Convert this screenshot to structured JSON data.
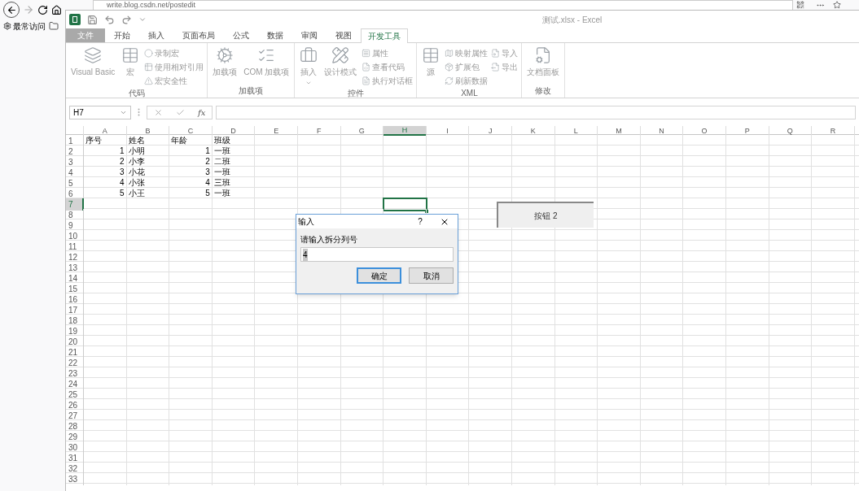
{
  "browser": {
    "url": "write.blog.csdn.net/postedit",
    "bookmarks": [
      {
        "label": "最常访问",
        "kind": "gear"
      },
      {
        "kind": "folder"
      }
    ]
  },
  "window": {
    "title": "测试.xlsx - Excel"
  },
  "tabs": [
    {
      "label": "文件",
      "kind": "file",
      "selected": false
    },
    {
      "label": "开始",
      "kind": "tab",
      "selected": false
    },
    {
      "label": "插入",
      "kind": "tab",
      "selected": false
    },
    {
      "label": "页面布局",
      "kind": "tab",
      "selected": false
    },
    {
      "label": "公式",
      "kind": "tab",
      "selected": false
    },
    {
      "label": "数据",
      "kind": "tab",
      "selected": false
    },
    {
      "label": "审阅",
      "kind": "tab",
      "selected": false
    },
    {
      "label": "视图",
      "kind": "tab",
      "selected": false
    },
    {
      "label": "开发工具",
      "kind": "tab",
      "selected": true
    }
  ],
  "ribbon_groups": [
    {
      "title": "代码",
      "large": [
        {
          "label": "Visual Basic",
          "disabled": true
        },
        {
          "label": "宏",
          "disabled": true
        }
      ],
      "small": [
        [
          {
            "label": "录制宏",
            "disabled": true
          },
          {
            "label": "使用相对引用",
            "disabled": true
          },
          {
            "label": "宏安全性",
            "disabled": true
          }
        ]
      ]
    },
    {
      "title": "加载项",
      "large": [
        {
          "label": "加载项",
          "disabled": true
        },
        {
          "label": "COM 加载项",
          "disabled": true
        }
      ]
    },
    {
      "title": "控件",
      "large": [
        {
          "label": "插入",
          "disabled": true,
          "dropdown": true
        },
        {
          "label": "设计模式",
          "disabled": true
        }
      ],
      "small": [
        [
          {
            "label": "属性",
            "disabled": true
          },
          {
            "label": "查看代码",
            "disabled": true
          },
          {
            "label": "执行对话框",
            "disabled": true
          }
        ]
      ]
    },
    {
      "title": "XML",
      "large": [
        {
          "label": "源",
          "disabled": true
        }
      ],
      "small": [
        [
          {
            "label": "映射属性",
            "disabled": true
          },
          {
            "label": "扩展包",
            "disabled": true
          },
          {
            "label": "刷新数据",
            "disabled": true
          }
        ],
        [
          {
            "label": "导入",
            "disabled": true
          },
          {
            "label": "导出",
            "disabled": true
          }
        ]
      ]
    },
    {
      "title": "修改",
      "large": [
        {
          "label": "文档面板",
          "disabled": true
        }
      ]
    }
  ],
  "formula_bar": {
    "name_box": "H7",
    "function_label": "fx"
  },
  "sheet": {
    "columns": [
      {
        "label": "A",
        "selected": false
      },
      {
        "label": "B",
        "selected": false
      },
      {
        "label": "C",
        "selected": false
      },
      {
        "label": "D",
        "selected": false
      },
      {
        "label": "E",
        "selected": false
      },
      {
        "label": "F",
        "selected": false
      },
      {
        "label": "G",
        "selected": false
      },
      {
        "label": "H",
        "selected": true
      },
      {
        "label": "I",
        "selected": false
      },
      {
        "label": "J",
        "selected": false
      },
      {
        "label": "K",
        "selected": false
      },
      {
        "label": "L",
        "selected": false
      },
      {
        "label": "M",
        "selected": false
      },
      {
        "label": "N",
        "selected": false
      },
      {
        "label": "O",
        "selected": false
      },
      {
        "label": "P",
        "selected": false
      },
      {
        "label": "Q",
        "selected": false
      },
      {
        "label": "R",
        "selected": false
      }
    ],
    "rows": [
      {
        "label": "1",
        "selected": false,
        "cells": [
          {
            "text": "序号",
            "kind": "text"
          },
          {
            "text": "姓名",
            "kind": "text"
          },
          {
            "text": "年龄",
            "kind": "text"
          },
          {
            "text": "班级",
            "kind": "text"
          }
        ]
      },
      {
        "label": "2",
        "selected": false,
        "cells": [
          {
            "text": "1",
            "kind": "number"
          },
          {
            "text": "小明",
            "kind": "text"
          },
          {
            "text": "1",
            "kind": "number"
          },
          {
            "text": "一班",
            "kind": "text"
          }
        ]
      },
      {
        "label": "3",
        "selected": false,
        "cells": [
          {
            "text": "2",
            "kind": "number"
          },
          {
            "text": "小李",
            "kind": "text"
          },
          {
            "text": "2",
            "kind": "number"
          },
          {
            "text": "二班",
            "kind": "text"
          }
        ]
      },
      {
        "label": "4",
        "selected": false,
        "cells": [
          {
            "text": "3",
            "kind": "number"
          },
          {
            "text": "小花",
            "kind": "text"
          },
          {
            "text": "3",
            "kind": "number"
          },
          {
            "text": "一班",
            "kind": "text"
          }
        ]
      },
      {
        "label": "5",
        "selected": false,
        "cells": [
          {
            "text": "4",
            "kind": "number"
          },
          {
            "text": "小张",
            "kind": "text"
          },
          {
            "text": "4",
            "kind": "number"
          },
          {
            "text": "三班",
            "kind": "text"
          }
        ]
      },
      {
        "label": "6",
        "selected": false,
        "cells": [
          {
            "text": "5",
            "kind": "number"
          },
          {
            "text": "小王",
            "kind": "text"
          },
          {
            "text": "5",
            "kind": "number"
          },
          {
            "text": "一班",
            "kind": "text"
          }
        ]
      },
      {
        "label": "7",
        "selected": true
      },
      {
        "label": "8",
        "selected": false
      },
      {
        "label": "9",
        "selected": false
      },
      {
        "label": "10",
        "selected": false
      },
      {
        "label": "11",
        "selected": false
      },
      {
        "label": "12",
        "selected": false
      },
      {
        "label": "13",
        "selected": false
      },
      {
        "label": "14",
        "selected": false
      },
      {
        "label": "15",
        "selected": false
      },
      {
        "label": "16",
        "selected": false
      },
      {
        "label": "17",
        "selected": false
      },
      {
        "label": "18",
        "selected": false
      },
      {
        "label": "19",
        "selected": false
      },
      {
        "label": "20",
        "selected": false
      },
      {
        "label": "21",
        "selected": false
      },
      {
        "label": "22",
        "selected": false
      },
      {
        "label": "23",
        "selected": false
      },
      {
        "label": "24",
        "selected": false
      },
      {
        "label": "25",
        "selected": false
      },
      {
        "label": "26",
        "selected": false
      },
      {
        "label": "27",
        "selected": false
      },
      {
        "label": "28",
        "selected": false
      },
      {
        "label": "29",
        "selected": false
      },
      {
        "label": "30",
        "selected": false
      },
      {
        "label": "31",
        "selected": false
      },
      {
        "label": "32",
        "selected": false
      },
      {
        "label": "33",
        "selected": false
      }
    ]
  },
  "sheet_button": {
    "label": "按钮 2"
  },
  "dialog": {
    "title": "输入",
    "help": "?",
    "prompt": "请输入拆分列号",
    "value": "4",
    "buttons": [
      {
        "label": "确定",
        "default": true
      },
      {
        "label": "取消",
        "default": false
      }
    ]
  }
}
